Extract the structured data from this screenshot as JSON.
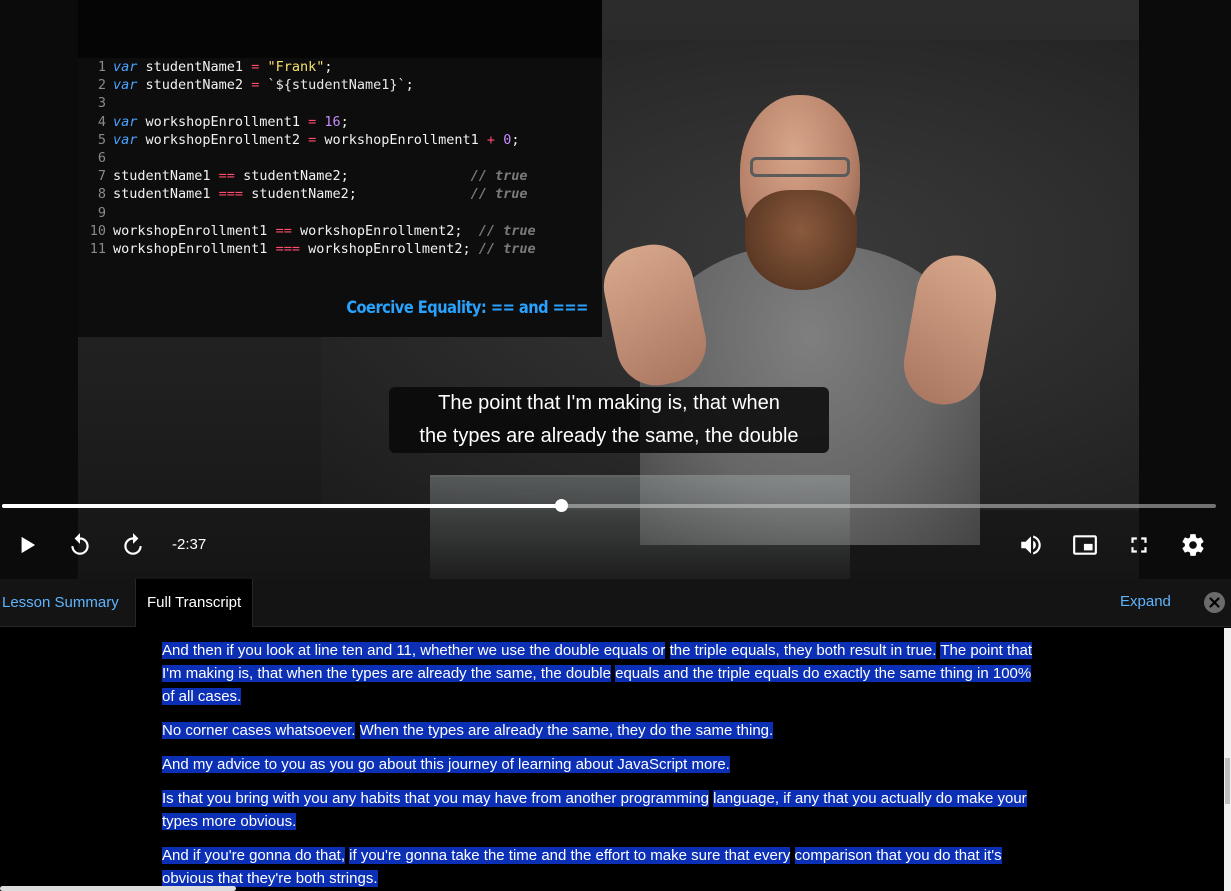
{
  "slide": {
    "code_lines": [
      {
        "n": "1",
        "html": "<span class=\"kw\">var</span> studentName1 <span class=\"op\">=</span> <span class=\"str\">\"Frank\"</span>;"
      },
      {
        "n": "2",
        "html": "<span class=\"kw\">var</span> studentName2 <span class=\"op\">=</span> <span class=\"tpl\">`${studentName1}`</span>;"
      },
      {
        "n": "3",
        "html": ""
      },
      {
        "n": "4",
        "html": "<span class=\"kw\">var</span> workshopEnrollment1 <span class=\"op\">=</span> <span class=\"num\">16</span>;"
      },
      {
        "n": "5",
        "html": "<span class=\"kw\">var</span> workshopEnrollment2 <span class=\"op\">=</span> workshopEnrollment1 <span class=\"op\">+</span> <span class=\"num\">0</span>;"
      },
      {
        "n": "6",
        "html": ""
      },
      {
        "n": "7",
        "html": "studentName1 <span class=\"op\">==</span> studentName2;               <span class=\"cm\">// true</span>"
      },
      {
        "n": "8",
        "html": "studentName1 <span class=\"op\">===</span> studentName2;              <span class=\"cm\">// true</span>"
      },
      {
        "n": "9",
        "html": ""
      },
      {
        "n": "10",
        "html": "workshopEnrollment1 <span class=\"op\">==</span> workshopEnrollment2;  <span class=\"cm\">// true</span>"
      },
      {
        "n": "11",
        "html": "workshopEnrollment1 <span class=\"op\">===</span> workshopEnrollment2; <span class=\"cm\">// true</span>"
      }
    ],
    "title": "Coercive Equality: == and ==="
  },
  "caption": {
    "line1": "The point that I'm making is, that when",
    "line2": "the types are already the same, the double"
  },
  "player": {
    "progress_fraction": 0.4605,
    "time_remaining": "-2:37",
    "icons": {
      "play": "play-icon",
      "rewind": "rewind-icon",
      "forward": "forward-icon",
      "volume": "volume-icon",
      "pip": "picture-in-picture-icon",
      "fullscreen": "fullscreen-icon",
      "settings": "gear-icon"
    }
  },
  "tabs": {
    "summary": "Lesson Summary",
    "transcript": "Full Transcript",
    "expand": "Expand"
  },
  "transcript": [
    [
      "And then if you look at line ten and 11, whether we use the double equals or",
      "the triple equals, they both result in true.",
      "The point that I'm making is, that when the types are already the same, the double",
      "equals and the triple equals do exactly the same thing in 100% of all cases."
    ],
    [
      "No corner cases whatsoever.",
      "When the types are already the same, they do the same thing."
    ],
    [
      "And my advice to you as you go about this journey of learning about JavaScript more."
    ],
    [
      "Is that you bring with you any habits that you may have from another programming",
      "language, if any that you actually do make your types more obvious."
    ],
    [
      "And if you're gonna do that,",
      "if you're gonna take the time and the effort to make sure that every",
      "comparison that you do that it's obvious that they're both strings."
    ]
  ],
  "colors": {
    "accent": "#5fb4ff",
    "highlight": "#0b30b6"
  }
}
